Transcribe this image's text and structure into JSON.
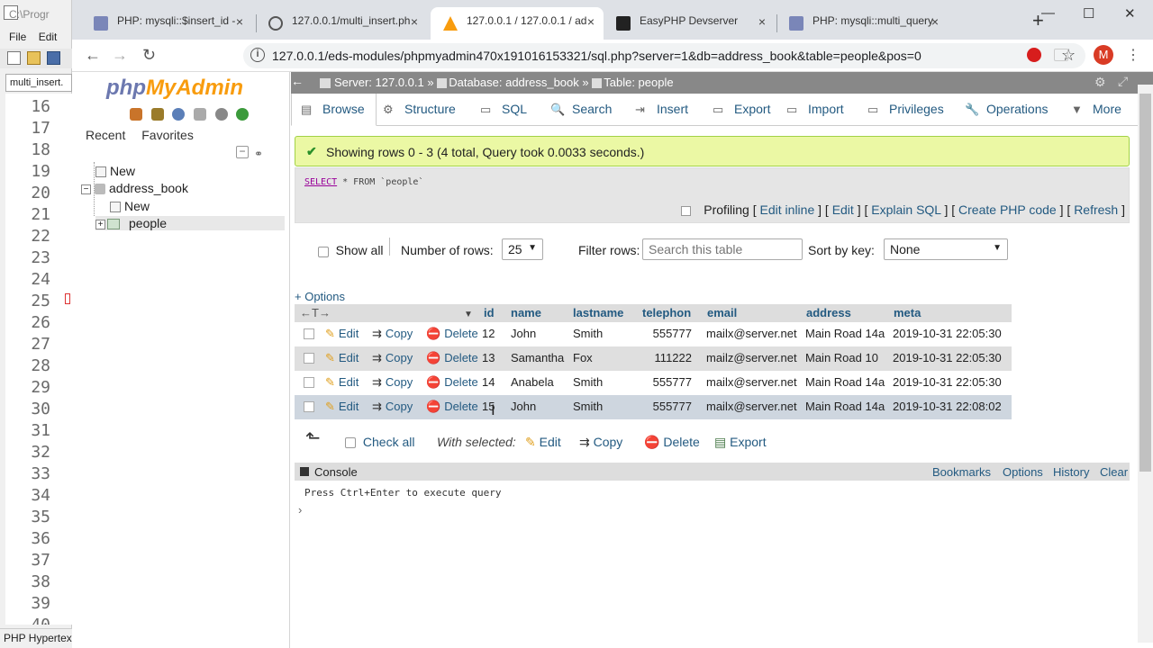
{
  "editor": {
    "title": "C:\\Progr",
    "menu": [
      "File",
      "Edit"
    ],
    "tab": "multi_insert.",
    "line_numbers": [
      "16",
      "17",
      "18",
      "19",
      "20",
      "21",
      "22",
      "23",
      "24",
      "25",
      "26",
      "27",
      "28",
      "29",
      "30",
      "31",
      "32",
      "33",
      "34",
      "35",
      "36",
      "37",
      "38",
      "39",
      "40"
    ],
    "status": "PHP Hypertex"
  },
  "browser": {
    "tabs": [
      {
        "label": "PHP: mysqli::$insert_id -",
        "close": "×"
      },
      {
        "label": "127.0.0.1/multi_insert.ph",
        "close": "×"
      },
      {
        "label": "127.0.0.1 / 127.0.0.1 / ad",
        "close": "×"
      },
      {
        "label": "EasyPHP Devserver",
        "close": "×"
      },
      {
        "label": "PHP: mysqli::multi_query",
        "close": "×"
      }
    ],
    "new_tab": "+",
    "window": {
      "minimize": "—",
      "maximize": "☐",
      "close": "✕"
    },
    "nav": {
      "back": "←",
      "forward": "→",
      "reload": "↻"
    },
    "url": "127.0.0.1/eds-modules/phpmyadmin470x191016153321/sql.php?server=1&db=address_book&table=people&pos=0",
    "info_icon": "i",
    "star": "☆",
    "profile_initial": "M",
    "menu_dots": "⋮"
  },
  "pma": {
    "logo": {
      "part1": "php",
      "part2": "MyAdmin"
    },
    "nav_tabs": [
      "Recent",
      "Favorites"
    ],
    "tree": {
      "new_root": "New",
      "db": "address_book",
      "new_table": "New",
      "table": "people"
    },
    "breadcrumb": {
      "server": "Server: 127.0.0.1",
      "database": "Database: address_book",
      "table": "Table: people",
      "sep": "»"
    },
    "menu": [
      "Browse",
      "Structure",
      "SQL",
      "Search",
      "Insert",
      "Export",
      "Import",
      "Privileges",
      "Operations",
      "More"
    ],
    "menu_icons": [
      "▤",
      "⚙",
      "▭",
      "🔍",
      "⇥",
      "▭",
      "▭",
      "▭",
      "🔧",
      "▼"
    ],
    "success_msg": "Showing rows 0 - 3 (4 total, Query took 0.0033 seconds.)",
    "sql": {
      "kw": "SELECT",
      "rest": " * FROM `people`"
    },
    "profiling": {
      "label": "Profiling",
      "links": [
        "Edit inline",
        "Edit",
        "Explain SQL",
        "Create PHP code",
        "Refresh"
      ],
      "open": "[",
      "close": "]"
    },
    "controls": {
      "show_all": "Show all",
      "num_rows_label": "Number of rows:",
      "num_rows_value": "25",
      "filter_label": "Filter rows:",
      "filter_placeholder": "Search this table",
      "sort_label": "Sort by key:",
      "sort_value": "None"
    },
    "options_link": "+ Options",
    "columns": [
      "id",
      "name",
      "lastname",
      "telephon",
      "email",
      "address",
      "meta"
    ],
    "col_arrows": "←T→",
    "row_actions": {
      "edit": "Edit",
      "copy": "Copy",
      "delete": "Delete"
    },
    "rows": [
      {
        "id": "12",
        "name": "John",
        "lastname": "Smith",
        "telephon": "555777",
        "email": "mailx@server.net",
        "address": "Main Road 14a",
        "meta": "2019-10-31 22:05:30"
      },
      {
        "id": "13",
        "name": "Samantha",
        "lastname": "Fox",
        "telephon": "111222",
        "email": "mailz@server.net",
        "address": "Main Road 10",
        "meta": "2019-10-31 22:05:30"
      },
      {
        "id": "14",
        "name": "Anabela",
        "lastname": "Smith",
        "telephon": "555777",
        "email": "mailx@server.net",
        "address": "Main Road 14a",
        "meta": "2019-10-31 22:05:30"
      },
      {
        "id": "15",
        "name": "John",
        "lastname": "Smith",
        "telephon": "555777",
        "email": "mailx@server.net",
        "address": "Main Road 14a",
        "meta": "2019-10-31 22:08:02"
      }
    ],
    "bottom": {
      "check_all": "Check all",
      "with_selected": "With selected:",
      "edit": "Edit",
      "copy": "Copy",
      "delete": "Delete",
      "export": "Export"
    },
    "console": {
      "title": "Console",
      "links": [
        "Bookmarks",
        "Options",
        "History",
        "Clear"
      ],
      "hint": "Press Ctrl+Enter to execute query",
      "prompt": "›"
    }
  },
  "colors": {
    "link": "#235a81",
    "success_bg": "#ebf8a4",
    "success_border": "#a2d246",
    "topbar": "#888888",
    "header_bg": "#dddddd",
    "row_odd": "#ffffff",
    "row_even": "#dfdfdf",
    "row_hover": "#ced6df",
    "delete_red": "#d9342b"
  }
}
